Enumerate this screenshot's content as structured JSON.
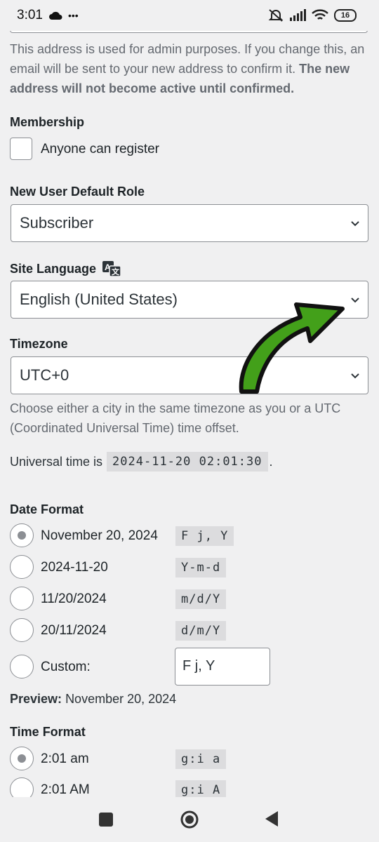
{
  "status": {
    "time": "3:01",
    "dots": "•••",
    "battery": "16"
  },
  "email_description": {
    "text": "This address is used for admin purposes. If you change this, an email will be sent to your new address to confirm it. ",
    "bold": "The new address will not become active until confirmed."
  },
  "membership": {
    "label": "Membership",
    "checkbox_label": "Anyone can register"
  },
  "default_role": {
    "label": "New User Default Role",
    "value": "Subscriber"
  },
  "site_language": {
    "label": "Site Language",
    "value": "English (United States)"
  },
  "timezone": {
    "label": "Timezone",
    "value": "UTC+0",
    "help": "Choose either a city in the same timezone as you or a UTC (Coordinated Universal Time) time offset.",
    "universal_prefix": "Universal time is",
    "universal_value": "2024-11-20 02:01:30",
    "universal_suffix": "."
  },
  "date_format": {
    "label": "Date Format",
    "options": [
      {
        "label": "November 20, 2024",
        "code": "F j, Y",
        "checked": true
      },
      {
        "label": "2024-11-20",
        "code": "Y-m-d",
        "checked": false
      },
      {
        "label": "11/20/2024",
        "code": "m/d/Y",
        "checked": false
      },
      {
        "label": "20/11/2024",
        "code": "d/m/Y",
        "checked": false
      }
    ],
    "custom_label": "Custom:",
    "custom_value": "F j, Y",
    "preview_label": "Preview:",
    "preview_value": "November 20, 2024"
  },
  "time_format": {
    "label": "Time Format",
    "options": [
      {
        "label": "2:01 am",
        "code": "g:i a",
        "checked": true
      },
      {
        "label": "2:01 AM",
        "code": "g:i A",
        "checked": false
      }
    ]
  },
  "colors": {
    "arrow": "#43a01a",
    "outline": "#111111"
  }
}
